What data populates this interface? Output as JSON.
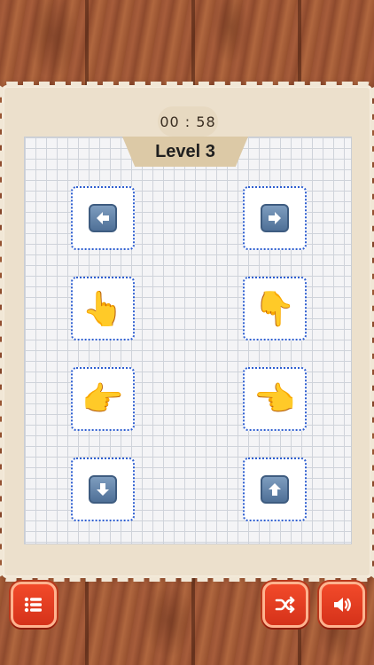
{
  "timer": {
    "text": "00 : 58"
  },
  "level": {
    "title": "Level 3"
  },
  "cards": [
    {
      "id": "left-arrow",
      "icon": "left-arrow-icon"
    },
    {
      "id": "right-arrow",
      "icon": "right-arrow-icon"
    },
    {
      "id": "hand-pointing-up",
      "icon": "hand-pointing-up-icon",
      "glyph": "👆"
    },
    {
      "id": "hand-pointing-down",
      "icon": "hand-pointing-down-icon",
      "glyph": "👇"
    },
    {
      "id": "hand-pointing-right",
      "icon": "hand-pointing-right-icon",
      "glyph": "👉"
    },
    {
      "id": "hand-pointing-left",
      "icon": "hand-pointing-left-icon",
      "glyph": "👈"
    },
    {
      "id": "down-arrow",
      "icon": "down-arrow-icon"
    },
    {
      "id": "up-arrow",
      "icon": "up-arrow-icon"
    }
  ],
  "controls": {
    "menu": "list-menu-icon",
    "shuffle": "shuffle-icon",
    "sound": "speaker-icon"
  },
  "colors": {
    "button": "#e3391f",
    "card_border": "#2f5fd0",
    "parchment": "#ece0cc"
  }
}
